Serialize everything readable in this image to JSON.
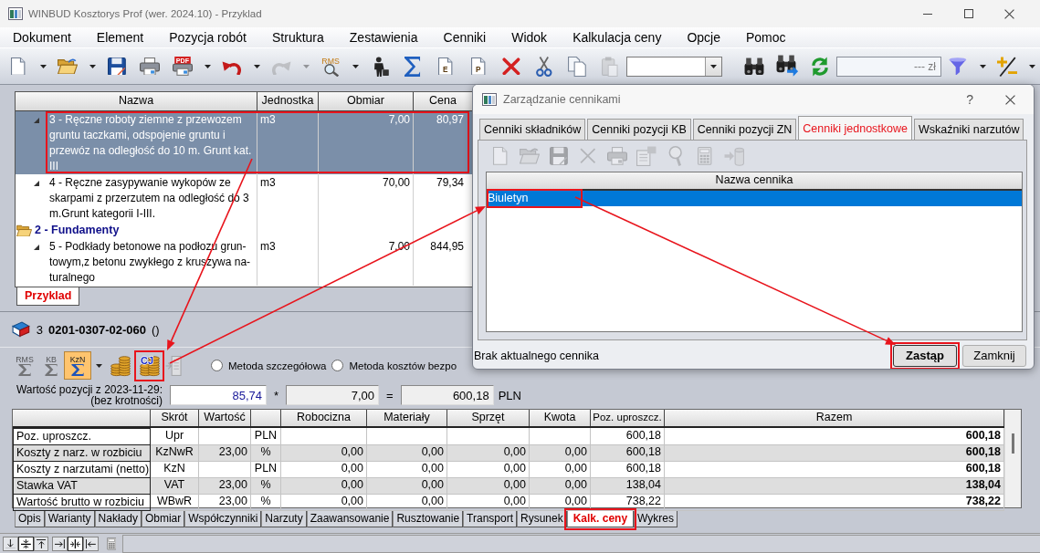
{
  "window": {
    "title": "WINBUD Kosztorys Prof (wer. 2024.10) - Przyklad"
  },
  "menu": [
    "Dokument",
    "Element",
    "Pozycja robót",
    "Struktura",
    "Zestawienia",
    "Cenniki",
    "Widok",
    "Kalkulacja ceny",
    "Opcje",
    "Pomoc"
  ],
  "toolbar": [
    {
      "kind": "doc",
      "disabled": false
    },
    {
      "kind": "caret",
      "disabled": false
    },
    {
      "kind": "open-file",
      "disabled": false
    },
    {
      "kind": "caret",
      "disabled": false
    },
    {
      "kind": "floppy",
      "disabled": false
    },
    {
      "kind": "printer",
      "disabled": false
    },
    {
      "kind": "pdf-printer",
      "label": "PDF",
      "disabled": false
    },
    {
      "kind": "caret",
      "disabled": false
    },
    {
      "kind": "undo",
      "disabled": false
    },
    {
      "kind": "caret",
      "disabled": false
    },
    {
      "kind": "redo",
      "disabled": true
    },
    {
      "kind": "caret",
      "disabled": true
    },
    {
      "kind": "rms-search",
      "label": "RMS",
      "disabled": false
    },
    {
      "kind": "caret",
      "disabled": false
    },
    {
      "kind": "person",
      "disabled": false
    },
    {
      "kind": "sigma",
      "disabled": false
    },
    {
      "kind": "doc-letter",
      "label": "E",
      "disabled": false
    },
    {
      "kind": "doc-letter",
      "label": "P",
      "disabled": false
    },
    {
      "kind": "delete",
      "disabled": false
    },
    {
      "kind": "scissors",
      "disabled": false
    },
    {
      "kind": "copy",
      "disabled": false
    },
    {
      "kind": "clipboard",
      "disabled": true
    },
    {
      "kind": "combo",
      "disabled": false
    },
    {
      "kind": "binoculars",
      "disabled": false
    },
    {
      "kind": "binoculars-arrow",
      "disabled": false
    },
    {
      "kind": "refresh",
      "disabled": false
    },
    {
      "kind": "amount",
      "placeholder": "--- zł",
      "disabled": false
    },
    {
      "kind": "funnel",
      "disabled": false
    },
    {
      "kind": "caret",
      "disabled": false
    },
    {
      "kind": "plus-minus",
      "disabled": false
    },
    {
      "kind": "caret",
      "disabled": false
    }
  ],
  "tree_table": {
    "columns": [
      "Nazwa",
      "Jednostka",
      "Obmiar",
      "Cena"
    ],
    "rows": [
      {
        "kind": "position",
        "name": "3 - Ręczne roboty ziemne z przewozem gruntu taczkami, odspojenie gruntu i przewóz na odległość do 10 m. Grunt kat. III",
        "unit": "m3",
        "quantity": "7,00",
        "price": "80,97",
        "selected": true,
        "highlighted": true
      },
      {
        "kind": "position",
        "name": "4 - Ręczne zasypywanie wykopów ze skarpami z przerzutem na odległość do 3 m.Grunt kategorii I-III.",
        "unit": "m3",
        "quantity": "70,00",
        "price": "79,34",
        "selected": false,
        "highlighted": false
      },
      {
        "kind": "group",
        "name": "2 - Fundamenty",
        "expanded": true,
        "selected": false,
        "highlighted": false,
        "children": [
          {
            "kind": "position",
            "name": "5 - Podkłady betonowe na podłozu grun-towym,z betonu zwykłego z kruszywa na-turalnego",
            "unit": "m3",
            "quantity": "7,00",
            "price": "844,95",
            "selected": false,
            "highlighted": false
          }
        ]
      }
    ]
  },
  "sheet_tabs": [
    {
      "label": "Przyklad",
      "selected": true
    }
  ],
  "position": {
    "number": "3",
    "code": "0201-0307-02-060",
    "note": "()"
  },
  "calc_toolbar": {
    "tools": [
      {
        "kind": "sum-label",
        "label": "RMS",
        "disabled": true,
        "pressed": false,
        "highlighted": false
      },
      {
        "kind": "sum-label",
        "label": "KB",
        "disabled": true,
        "pressed": false,
        "highlighted": false
      },
      {
        "kind": "sum-label",
        "label": "KzN",
        "disabled": false,
        "pressed": true,
        "highlighted": false
      },
      {
        "kind": "caret",
        "disabled": false,
        "pressed": false,
        "highlighted": false
      },
      {
        "kind": "coins",
        "disabled": false,
        "pressed": false,
        "highlighted": false
      },
      {
        "kind": "coins-label",
        "label": "CJ",
        "disabled": false,
        "pressed": false,
        "highlighted": true
      },
      {
        "kind": "export",
        "disabled": true,
        "pressed": false,
        "highlighted": false
      }
    ],
    "methods": [
      {
        "label": "Metoda szczegółowa",
        "selected": false
      },
      {
        "label": "Metoda kosztów bezpo",
        "selected": false
      }
    ]
  },
  "position_value": {
    "label": "Wartość pozycji z 2023-11-29:",
    "note": "(bez krotności)",
    "unit_price": "85,74",
    "times": "*",
    "quantity": "7,00",
    "equals": "=",
    "total": "600,18",
    "currency": "PLN"
  },
  "calc_table": {
    "columns": {
      "abbr": "Skrót",
      "value": "Wartość",
      "labor": "Robocizna",
      "materials": "Materiały",
      "equipment": "Sprzęt",
      "amount": "Kwota",
      "simplified": "Poz. uproszcz.",
      "total": "Razem"
    },
    "rows": [
      {
        "name": "Poz. uproszcz.",
        "abbr": "Upr",
        "unit": "PLN",
        "simplified": "600,18",
        "total": "600,18"
      },
      {
        "name": "Koszty z narz. w rozbiciu",
        "abbr": "KzNwR",
        "value": "23,00",
        "unit": "%",
        "labor": "0,00",
        "materials": "0,00",
        "equipment": "0,00",
        "amount": "0,00",
        "simplified": "600,18",
        "total": "600,18"
      },
      {
        "name": "Koszty z narzutami (netto)",
        "abbr": "KzN",
        "unit": "PLN",
        "labor": "0,00",
        "materials": "0,00",
        "equipment": "0,00",
        "amount": "0,00",
        "simplified": "600,18",
        "total": "600,18"
      },
      {
        "name": "Stawka VAT",
        "abbr": "VAT",
        "value": "23,00",
        "unit": "%",
        "labor": "0,00",
        "materials": "0,00",
        "equipment": "0,00",
        "amount": "0,00",
        "simplified": "138,04",
        "total": "138,04"
      },
      {
        "name": "Wartość brutto w rozbiciu",
        "abbr": "WBwR",
        "value": "23,00",
        "unit": "%",
        "labor": "0,00",
        "materials": "0,00",
        "equipment": "0,00",
        "amount": "0,00",
        "simplified": "738,22",
        "total": "738,22"
      }
    ]
  },
  "bottom_tabs": [
    {
      "label": "Opis",
      "selected": false,
      "highlighted": false
    },
    {
      "label": "Warianty",
      "selected": false,
      "highlighted": false
    },
    {
      "label": "Nakłady",
      "selected": false,
      "highlighted": false
    },
    {
      "label": "Obmiar",
      "selected": false,
      "highlighted": false
    },
    {
      "label": "Współczynniki",
      "selected": false,
      "highlighted": false
    },
    {
      "label": "Narzuty",
      "selected": false,
      "highlighted": false
    },
    {
      "label": "Zaawansowanie",
      "selected": false,
      "highlighted": false
    },
    {
      "label": "Rusztowanie",
      "selected": false,
      "highlighted": false
    },
    {
      "label": "Transport",
      "selected": false,
      "highlighted": false
    },
    {
      "label": "Rysunek",
      "selected": false,
      "highlighted": false
    },
    {
      "label": "Kalk. ceny",
      "selected": true,
      "highlighted": true
    },
    {
      "label": "Wykres",
      "selected": false,
      "highlighted": false
    }
  ],
  "status_tools": [
    {
      "kind": "align-bottom",
      "pressed": false
    },
    {
      "kind": "align-middle",
      "pressed": true
    },
    {
      "kind": "align-top",
      "pressed": false
    },
    {
      "kind": "col-right",
      "pressed": false
    },
    {
      "kind": "col-middle",
      "pressed": true
    },
    {
      "kind": "col-left",
      "pressed": false
    },
    {
      "kind": "calculator",
      "pressed": false
    }
  ],
  "dialog": {
    "title": "Zarządzanie cennikami",
    "help": "?",
    "tabs": [
      {
        "label": "Cenniki składników",
        "selected": false
      },
      {
        "label": "Cenniki pozycji KB",
        "selected": false
      },
      {
        "label": "Cenniki pozycji ZN",
        "selected": false
      },
      {
        "label": "Cenniki jednostkowe",
        "selected": true
      },
      {
        "label": "Wskaźniki narzutów",
        "selected": false
      }
    ],
    "tools": [
      {
        "kind": "doc",
        "disabled": true
      },
      {
        "kind": "open-file",
        "disabled": true
      },
      {
        "kind": "floppy",
        "disabled": true
      },
      {
        "kind": "x-thin",
        "disabled": true
      },
      {
        "kind": "printer",
        "disabled": true
      },
      {
        "kind": "properties",
        "disabled": true
      },
      {
        "kind": "magnifier",
        "disabled": true
      },
      {
        "kind": "calculator",
        "disabled": true
      },
      {
        "kind": "import",
        "disabled": true
      }
    ],
    "list": {
      "column": "Nazwa cennika",
      "items": [
        {
          "label": "Biuletyn",
          "selected": true,
          "highlighted": true
        }
      ]
    },
    "status": "Brak aktualnego cennika",
    "buttons": [
      {
        "label": "Zastąp",
        "default": true,
        "highlighted": true
      },
      {
        "label": "Zamknij",
        "default": false,
        "highlighted": false
      }
    ]
  }
}
